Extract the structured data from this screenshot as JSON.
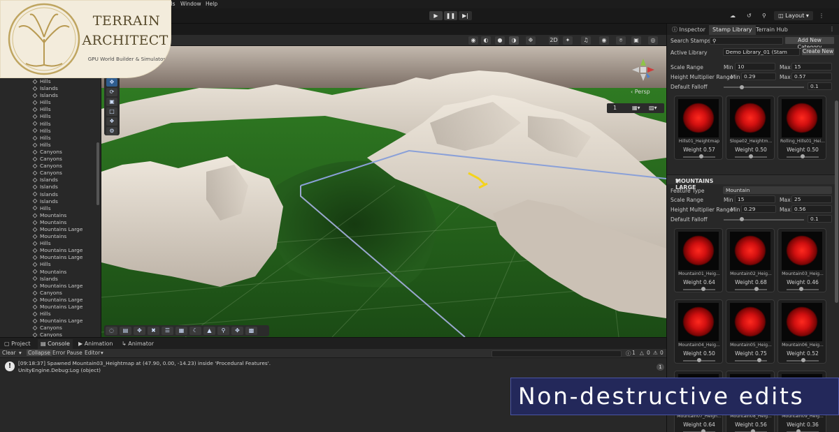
{
  "menu": {
    "items": [
      "bs",
      "Tools",
      "Window",
      "Help"
    ]
  },
  "toolbar": {
    "play_icon": "play-icon",
    "pause_icon": "pause-icon",
    "step_icon": "step-icon",
    "layout_label": "Layout"
  },
  "logo": {
    "title_line1": "TERRAIN",
    "title_line2": "ARCHITECT",
    "subtitle": "GPU World Builder & Simulator"
  },
  "hierarchy": {
    "items": [
      "Hills",
      "Islands",
      "Islands",
      "Hills",
      "Hills",
      "Hills",
      "Hills",
      "Hills",
      "Hills",
      "Hills",
      "Canyons",
      "Canyons",
      "Canyons",
      "Canyons",
      "Islands",
      "Islands",
      "Islands",
      "Islands",
      "Hills",
      "Mountains",
      "Mountains",
      "Mountains Large",
      "Mountains",
      "Hills",
      "Mountains Large",
      "Mountains Large",
      "Hills",
      "Mountains",
      "Islands",
      "Mountains Large",
      "Canyons",
      "Mountains Large",
      "Mountains Large",
      "Hills",
      "Mountains Large",
      "Canyons",
      "Canyons"
    ]
  },
  "scene": {
    "persp_label": "‹ Persp",
    "grid_value": "1"
  },
  "console": {
    "tabs": [
      "Project",
      "Console",
      "Animation",
      "Animator"
    ],
    "active_tab": "Console",
    "toolbar": {
      "clear": "Clear",
      "collapse": "Collapse",
      "error_pause": "Error Pause",
      "editor": "Editor",
      "info_count": "1",
      "warn_count": "0",
      "error_count": "0"
    },
    "log_line1": "[09:18:37] Spawned Mountain03_Heightmap at (47.90, 0.00, -14.23) inside 'Procedural Features'.",
    "log_line2": "UnityEngine.Debug:Log (object)",
    "log_count": "1"
  },
  "right": {
    "tabs": [
      "Inspector",
      "Stamp Library",
      "Terrain Hub"
    ],
    "active_tab": "Stamp Library",
    "search_label": "Search Stamps:",
    "add_category": "Add New Category",
    "active_library_label": "Active Library",
    "active_library_value": "Demo Library_01 (Stam",
    "create_new": "Create New",
    "section1": {
      "scale_label": "Scale Range",
      "scale_min_label": "Min",
      "scale_min": "10",
      "scale_max_label": "Max",
      "scale_max": "15",
      "height_label": "Height Multiplier Range",
      "height_min_label": "Min",
      "height_min": "0.29",
      "height_max_label": "Max",
      "height_max": "0.57",
      "falloff_label": "Default Falloff",
      "falloff": "0.1",
      "cards": [
        {
          "name": "Hills01_Heightmap",
          "weight": "Weight 0.57"
        },
        {
          "name": "Slope02_Heightm...",
          "weight": "Weight 0.50"
        },
        {
          "name": "Rolling_Hills01_Hei...",
          "weight": "Weight 0.50"
        }
      ]
    },
    "section2": {
      "title": "MOUNTAINS LARGE",
      "feature_label": "Feature Type",
      "feature_value": "Mountain",
      "scale_label": "Scale Range",
      "scale_min_label": "Min",
      "scale_min": "15",
      "scale_max_label": "Max",
      "scale_max": "25",
      "height_label": "Height Multiplier Range",
      "height_min_label": "Min",
      "height_min": "0.29",
      "height_max_label": "Max",
      "height_max": "0.56",
      "falloff_label": "Default Falloff",
      "falloff": "0.1",
      "cards": [
        {
          "name": "Mountain01_Heig...",
          "weight": "Weight 0.64"
        },
        {
          "name": "Mountain02_Heig...",
          "weight": "Weight 0.68"
        },
        {
          "name": "Mountain03_Heig...",
          "weight": "Weight 0.46"
        },
        {
          "name": "Mountain04_Heig...",
          "weight": "Weight 0.50"
        },
        {
          "name": "Mountain05_Heig...",
          "weight": "Weight 0.75"
        },
        {
          "name": "Mountain06_Heig...",
          "weight": "Weight 0.52"
        },
        {
          "name": "Mountain07_Heigh...",
          "weight": "Weight 0.64"
        },
        {
          "name": "Mountain08_Heig...",
          "weight": "Weight 0.56"
        },
        {
          "name": "Mountain09_Heig...",
          "weight": "Weight 0.36"
        }
      ]
    }
  },
  "caption": "Non-destructive edits",
  "colors": {
    "panel": "#282828",
    "terrain_green": "#1f5a18",
    "snow": "#d9d2c8",
    "accent_blue": "#2f5d8f",
    "stamp_red": "#e01a14",
    "caption_bg": "#23285a"
  }
}
